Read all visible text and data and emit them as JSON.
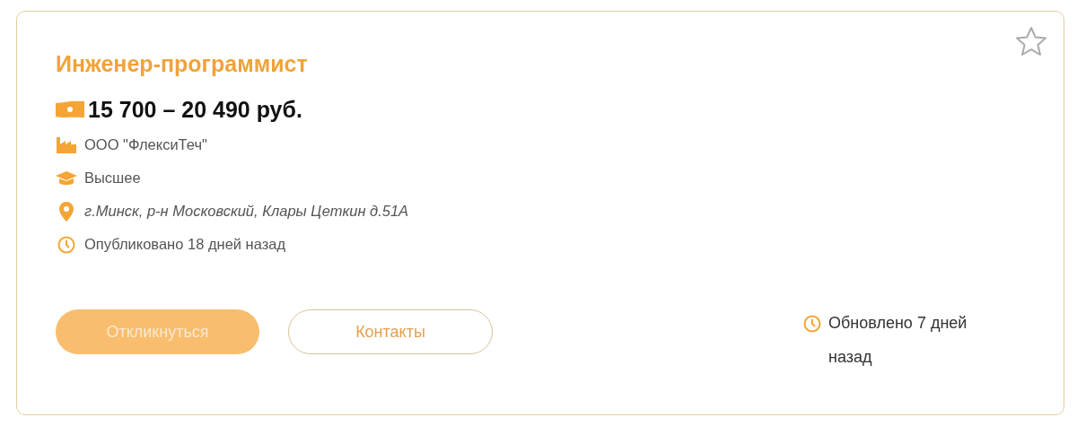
{
  "vacancy": {
    "title": "Инженер-программист",
    "favorite": false,
    "salary": "15 700 – 20 490 руб.",
    "details": [
      {
        "kind": "company",
        "text": "ООО \"ФлексиТеч\""
      },
      {
        "kind": "education",
        "text": "Высшее"
      },
      {
        "kind": "address",
        "text": "г.Минск, р-н Московский, Клары Цеткин д.51А"
      },
      {
        "kind": "published",
        "text": "Опубликовано 18 дней назад"
      }
    ],
    "buttons": [
      {
        "kind": "primary",
        "label": "Откликнуться"
      },
      {
        "kind": "outline",
        "label": "Контакты"
      }
    ],
    "updated": "Обновлено 7 дней назад"
  }
}
